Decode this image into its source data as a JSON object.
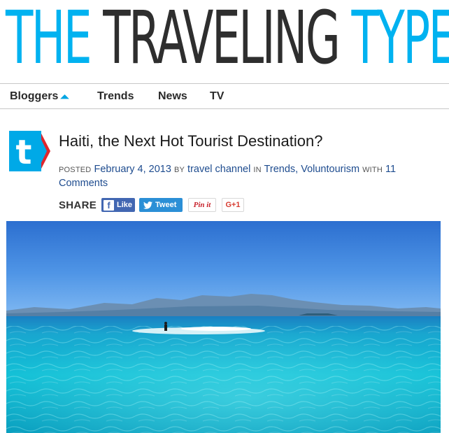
{
  "site": {
    "logo_part1": "THE ",
    "logo_part2": "TRAVELING ",
    "logo_part3": "TYPE"
  },
  "nav": {
    "items": [
      {
        "label": "Bloggers",
        "has_dropdown": true
      },
      {
        "label": "Trends"
      },
      {
        "label": "News"
      },
      {
        "label": "TV"
      }
    ]
  },
  "post": {
    "channel_icon_letter": "t",
    "title": "Haiti, the Next Hot Tourist Destination?",
    "posted_label": "POSTED",
    "date": "February 4, 2013",
    "by_label": "BY",
    "author": "travel channel",
    "in_label": "IN",
    "category1": "Trends",
    "separator": ",",
    "category2": "Voluntourism",
    "with_label": "WITH",
    "comments": "11 Comments"
  },
  "share": {
    "label": "SHARE",
    "facebook_label": "Like",
    "twitter_label": "Tweet",
    "pinterest_label": "Pin it",
    "gplus_label": "G+1"
  },
  "colors": {
    "accent_blue": "#00b2f0",
    "dark_logo": "#2e2e2e",
    "link": "#1e4c8f",
    "facebook": "#4267b2",
    "twitter": "#2b8fd6",
    "channel_red": "#e0262c"
  }
}
